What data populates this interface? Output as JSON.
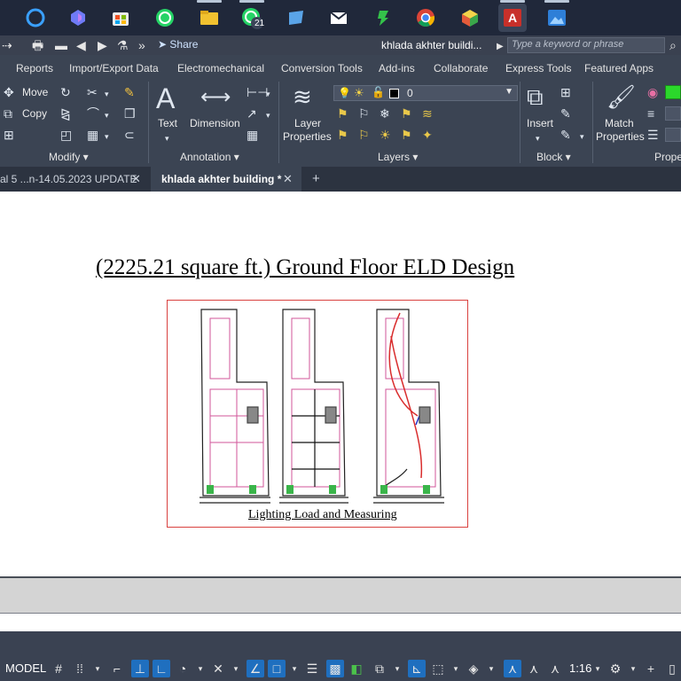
{
  "taskbar": {
    "apps": [
      "cortana-icon",
      "copilot-icon",
      "store-icon",
      "whatsapp-icon",
      "file-explorer-icon",
      "whatsapp-beta-icon",
      "outlook-icon",
      "mail-icon",
      "camo-icon",
      "chrome-icon",
      "cube-app-icon",
      "autocad-icon",
      "photos-icon"
    ],
    "whatsapp_badge": "21"
  },
  "quick_access": {
    "share_label": "Share",
    "document_title": "khlada akhter buildi...",
    "search_placeholder": "Type a keyword or phrase"
  },
  "ribbon_tabs": [
    "Reports",
    "Import/Export Data",
    "Electromechanical",
    "Conversion Tools",
    "Add-ins",
    "Collaborate",
    "Express Tools",
    "Featured Apps"
  ],
  "ribbon": {
    "modify": {
      "move": "Move",
      "copy": "Copy",
      "title": "Modify"
    },
    "annotation": {
      "text": "Text",
      "dimension": "Dimension",
      "title": "Annotation"
    },
    "layers": {
      "layer_properties_line1": "Layer",
      "layer_properties_line2": "Properties",
      "current_layer": "0",
      "title": "Layers"
    },
    "block": {
      "insert": "Insert",
      "title": "Block"
    },
    "properties": {
      "match_line1": "Match",
      "match_line2": "Properties",
      "title": "Prope"
    }
  },
  "doc_tabs": {
    "tab1": "al 5 ...n-14.05.2023 UPDATE",
    "tab2": "khlada akhter building *"
  },
  "drawing": {
    "title": "(2225.21 square ft.) Ground Floor ELD Design",
    "caption": "Lighting Load and Measuring"
  },
  "status": {
    "model": "MODEL",
    "scale": "1:16"
  },
  "colors": {
    "accent_blue": "#1f6fbf",
    "frame_red": "#d9413f"
  }
}
